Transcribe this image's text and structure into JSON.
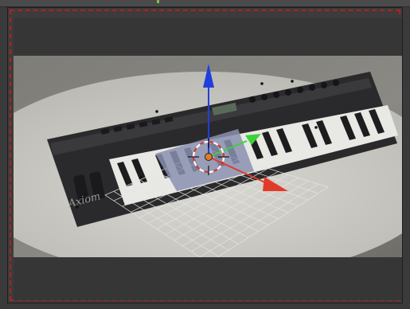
{
  "app": {
    "window_role": "3d-viewport"
  },
  "viewport": {
    "frame_color": "#b02020",
    "background_color": "#3c3c3c"
  },
  "scene": {
    "keyboard_brand": "Axiom",
    "gizmo": {
      "x_axis_color": "#e23a2a",
      "y_axis_color": "#3bd13b",
      "z_axis_color": "#1f3fdc",
      "cursor_color": "#ffffff",
      "origin_color": "#e07b2a"
    },
    "grid_color": "#e6e6e6",
    "plane_color": "#8a8fb0"
  },
  "icons": [
    "3d-cursor-icon",
    "transform-gizmo-icon"
  ]
}
